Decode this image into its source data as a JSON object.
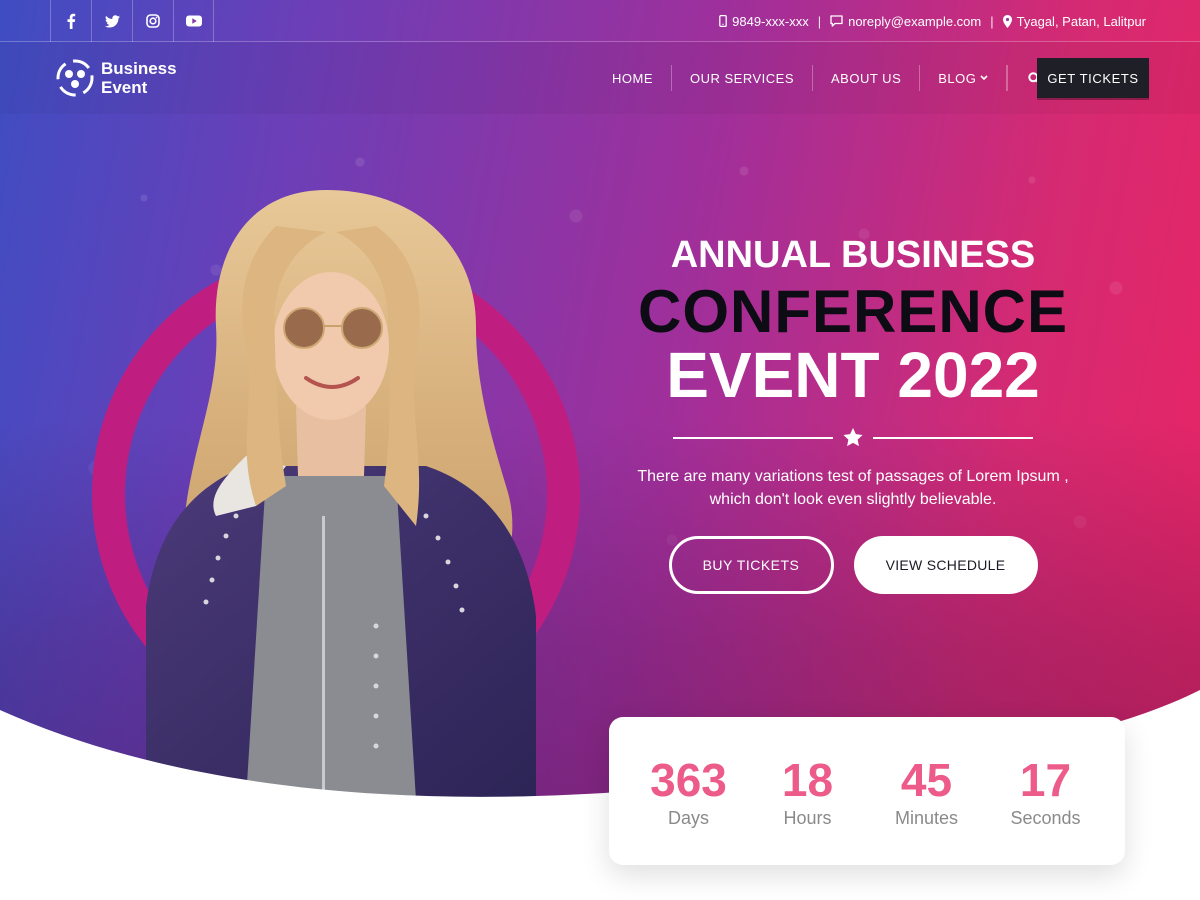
{
  "topbar": {
    "social": [
      {
        "icon": "facebook-icon"
      },
      {
        "icon": "twitter-icon"
      },
      {
        "icon": "instagram-icon"
      },
      {
        "icon": "youtube-icon"
      }
    ],
    "phone": "9849-xxx-xxx",
    "email": "noreply@example.com",
    "location": "Tyagal, Patan, Lalitpur",
    "separator": "|"
  },
  "navbar": {
    "logo_line1": "Business",
    "logo_line2": "Event",
    "items": [
      "HOME",
      "OUR SERVICES",
      "ABOUT US",
      "BLOG"
    ],
    "cta": "GET TICKETS"
  },
  "hero": {
    "line1": "ANNUAL BUSINESS",
    "line2": "CONFERENCE",
    "line3": "EVENT 2022",
    "description": "There are many variations test of passages of Lorem Ipsum , which don't look even slightly believable.",
    "buy_button": "BUY TICKETS",
    "schedule_button": "VIEW SCHEDULE"
  },
  "countdown": [
    {
      "value": "363",
      "label": "Days"
    },
    {
      "value": "18",
      "label": "Hours"
    },
    {
      "value": "45",
      "label": "Minutes"
    },
    {
      "value": "17",
      "label": "Seconds"
    }
  ],
  "colors": {
    "gradient_start": "#3f4dc2",
    "gradient_end": "#ea2463",
    "countdown_accent": "#ec5b8a",
    "cta_dark": "#1f1f27"
  }
}
